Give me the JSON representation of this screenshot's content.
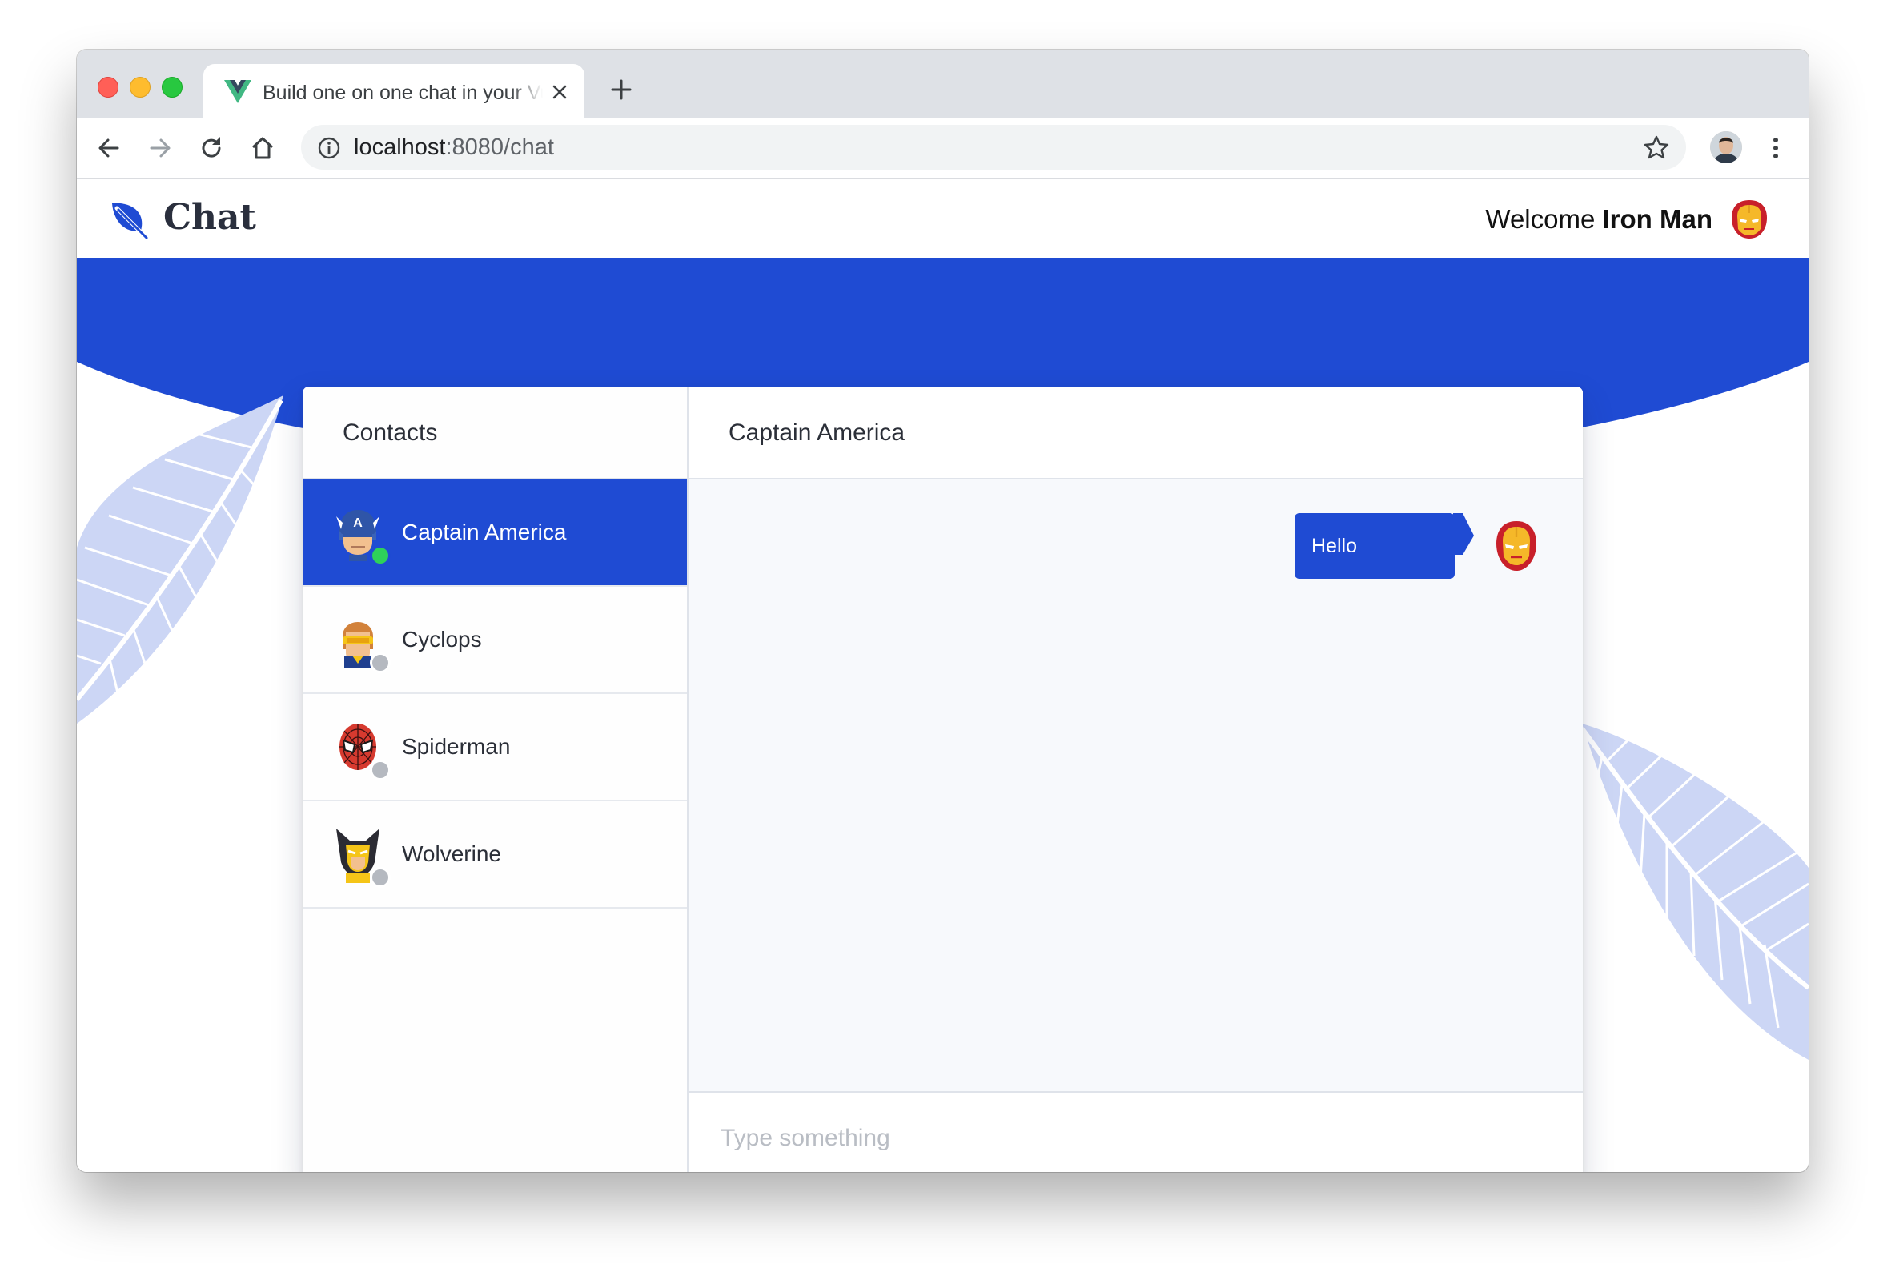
{
  "browser": {
    "tab_title": "Build one on one chat in your Vue app",
    "new_tab_label": "+",
    "url_host": "localhost",
    "url_rest": ":8080/chat"
  },
  "app": {
    "brand": "Chat",
    "welcome_prefix": "Welcome ",
    "username": "Iron Man",
    "accent_color": "#1f4bd3"
  },
  "contacts": {
    "header": "Contacts",
    "items": [
      {
        "name": "Captain America",
        "status": "online",
        "active": true,
        "icon": "captain-america-avatar-icon"
      },
      {
        "name": "Cyclops",
        "status": "offline",
        "active": false,
        "icon": "cyclops-avatar-icon"
      },
      {
        "name": "Spiderman",
        "status": "offline",
        "active": false,
        "icon": "spiderman-avatar-icon"
      },
      {
        "name": "Wolverine",
        "status": "offline",
        "active": false,
        "icon": "wolverine-avatar-icon"
      }
    ]
  },
  "chat": {
    "header": "Captain America",
    "messages": [
      {
        "text": "Hello",
        "sender": "Iron Man"
      }
    ],
    "composer_placeholder": "Type something"
  }
}
